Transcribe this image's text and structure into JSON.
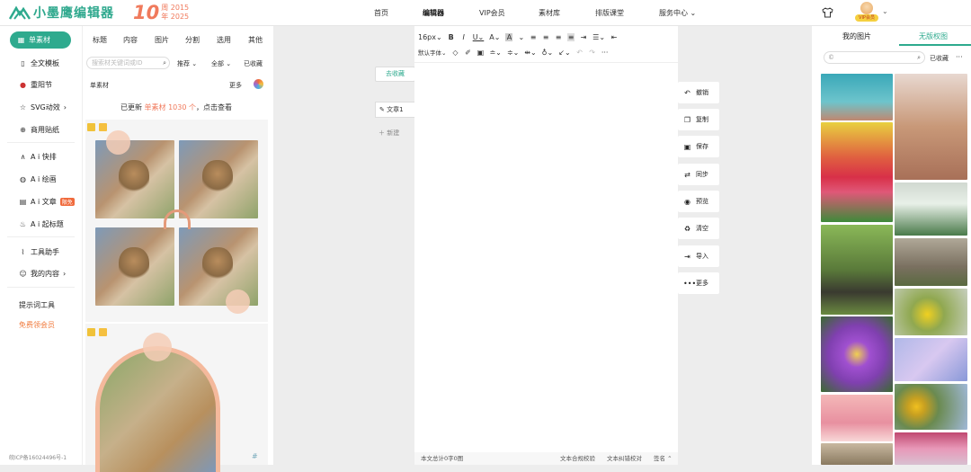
{
  "header": {
    "brand": "小墨鹰编辑器",
    "anniv_num": "10",
    "anniv_text1": "周 2015",
    "anniv_text2": "年 2025",
    "nav": [
      "首页",
      "编辑器",
      "VIP会员",
      "素材库",
      "排版课堂",
      "服务中心"
    ],
    "avatar_tag": "VIP会员",
    "brand_color": "#2eaa8e",
    "accent_color": "#f07a5c"
  },
  "sidebar": {
    "items": [
      {
        "label": "单素材",
        "icon": "grid-icon"
      },
      {
        "label": "全文模板",
        "icon": "template-icon"
      },
      {
        "label": "重阳节",
        "icon": "lantern-icon"
      },
      {
        "label": "SVG动效",
        "icon": "star-icon"
      },
      {
        "label": "商用贴纸",
        "icon": "sticker-icon"
      },
      {
        "label": "A i 快排",
        "icon": "ai-icon"
      },
      {
        "label": "A i 绘画",
        "icon": "palette-icon"
      },
      {
        "label": "A i 文章",
        "icon": "doc-icon",
        "badge": "限免"
      },
      {
        "label": "A i 起标题",
        "icon": "fire-icon"
      },
      {
        "label": "工具助手",
        "icon": "tool-icon"
      },
      {
        "label": "我的内容",
        "icon": "user-icon"
      },
      {
        "label": "提示词工具"
      },
      {
        "label": "免费领会员"
      }
    ],
    "icp": "皖ICP备16024496号-1"
  },
  "material": {
    "tabs": [
      "标题",
      "内容",
      "图片",
      "分割",
      "选用",
      "其他"
    ],
    "search_placeholder": "搜索材关键词或ID",
    "filter1": "推荐",
    "filter2": "全部",
    "collected": "已收藏",
    "section": "单素材",
    "more": "更多",
    "update_prefix": "已更新 ",
    "update_hl": "单素材 1030 个",
    "update_suffix": "，点击查看"
  },
  "docs": {
    "tab_active": "去收藏",
    "doc_name": "文章1",
    "new_label": "新建"
  },
  "editor": {
    "font_size": "16px",
    "font_family": "默认字体",
    "word_count": "本文总计0字0图",
    "check1": "文本合规校验",
    "check2": "文本纠错校对",
    "sign": "签名"
  },
  "actions": [
    {
      "label": "撤销",
      "icon": "undo-icon"
    },
    {
      "label": "复制",
      "icon": "copy-icon"
    },
    {
      "label": "保存",
      "icon": "save-icon"
    },
    {
      "label": "同步",
      "icon": "sync-icon"
    },
    {
      "label": "预览",
      "icon": "eye-icon"
    },
    {
      "label": "清空",
      "icon": "trash-icon"
    },
    {
      "label": "导入",
      "icon": "import-icon"
    },
    {
      "label": "更多",
      "icon": "more-icon"
    }
  ],
  "right": {
    "tab1": "我的图片",
    "tab2": "无版权图",
    "collected": "已收藏"
  }
}
